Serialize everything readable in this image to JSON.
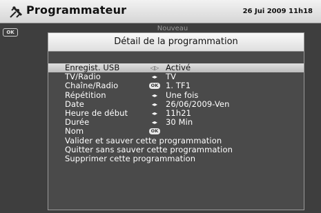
{
  "topbar": {
    "title": "Programmateur",
    "datetime": "26 Jui 2009 11h18",
    "icon": "satellite-icon"
  },
  "background": {
    "ok_key": "OK",
    "tab_label": "Nouveau"
  },
  "dialog": {
    "title": "Détail de la programmation",
    "rows": [
      {
        "label": "Enregist. USB",
        "mark": "left-right-arrows",
        "mark_text": "◁▷",
        "value": "Activé",
        "selected": true
      },
      {
        "label": "TV/Radio",
        "mark": "left-right-arrows",
        "mark_text": "◂▸",
        "value": "TV"
      },
      {
        "label": "Chaîne/Radio",
        "mark": "ok-key",
        "mark_text": "OK",
        "value": "1. TF1"
      },
      {
        "label": "Répétition",
        "mark": "left-right-arrows",
        "mark_text": "◂▸",
        "value": "Une fois"
      },
      {
        "label": "Date",
        "mark": "left-right-arrows",
        "mark_text": "◂▸",
        "value": "26/06/2009-Ven"
      },
      {
        "label": "Heure de début",
        "mark": "left-right-arrows",
        "mark_text": "◂▸",
        "value": "11h21"
      },
      {
        "label": "Durée",
        "mark": "left-right-arrows",
        "mark_text": "◂▸",
        "value": "30 Min"
      },
      {
        "label": "Nom",
        "mark": "ok-key",
        "mark_text": "OK",
        "value": ""
      }
    ],
    "actions": [
      "Valider et sauver cette programmation",
      "Quitter sans sauver cette programmation",
      "Supprimer cette programmation"
    ]
  }
}
